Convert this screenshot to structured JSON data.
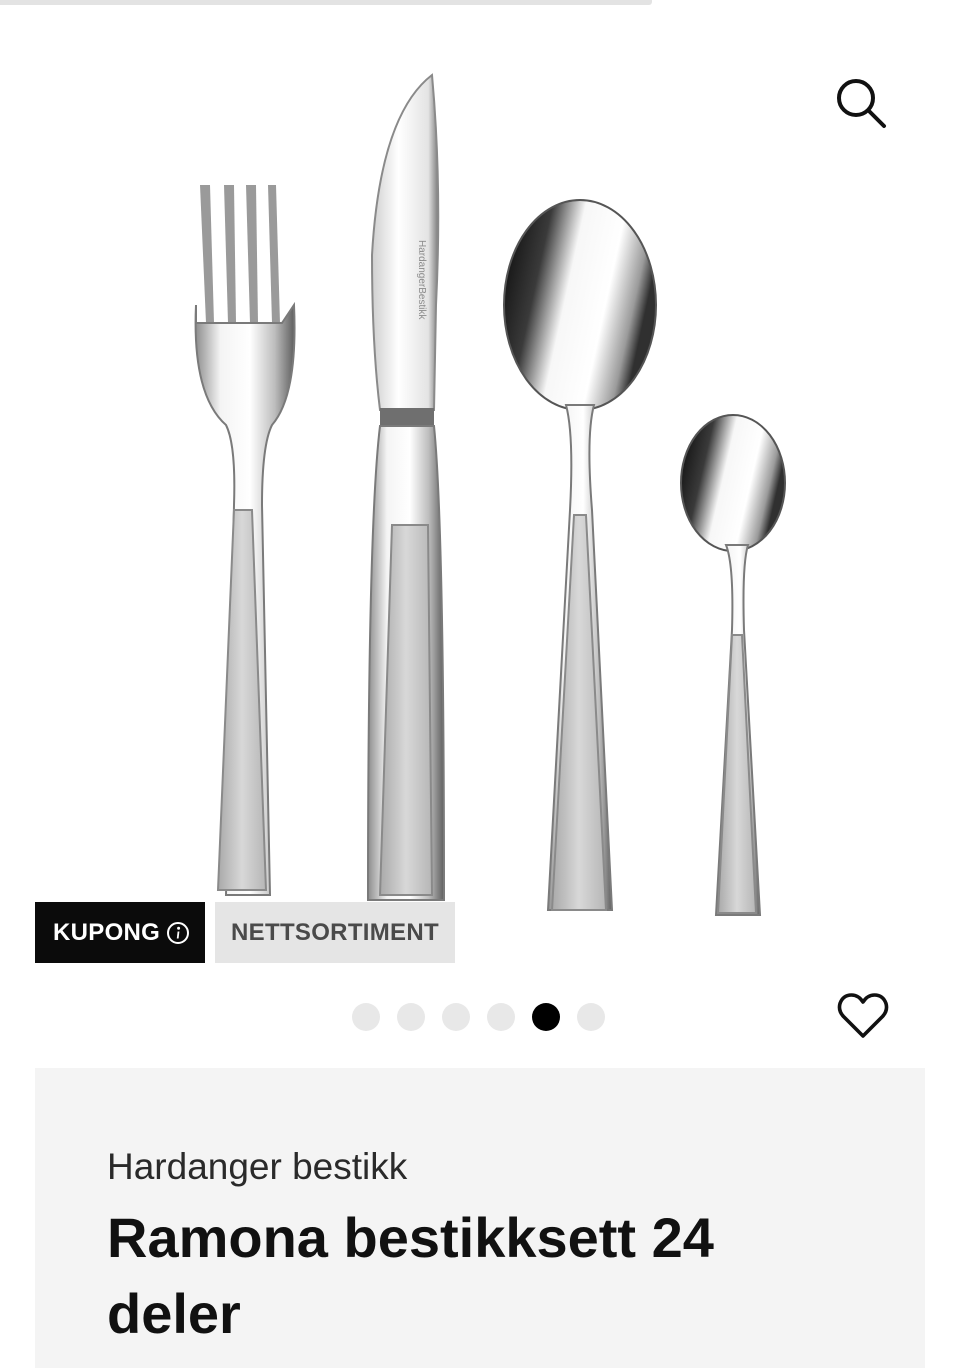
{
  "header": {
    "search_icon": "search-icon"
  },
  "hero": {
    "image_alt": "Ramona bestikksett 24 deler - gaffel, kniv, spiseskje, teskje",
    "engraving": "HardangerBestikk",
    "badges": {
      "kupong": "KUPONG",
      "kupong_icon": "info-icon",
      "nettsortiment": "NETTSORTIMENT"
    },
    "carousel": {
      "count": 6,
      "active_index": 4
    },
    "favorite_icon": "heart-icon"
  },
  "product": {
    "brand": "Hardanger bestikk",
    "title": "Ramona bestikksett 24 deler"
  },
  "colors": {
    "badge_dark": "#0b0b0b",
    "badge_light": "#e5e5e5",
    "panel_bg": "#f4f4f4",
    "dot_active": "#000000",
    "dot_inactive": "#e8e8e8"
  }
}
